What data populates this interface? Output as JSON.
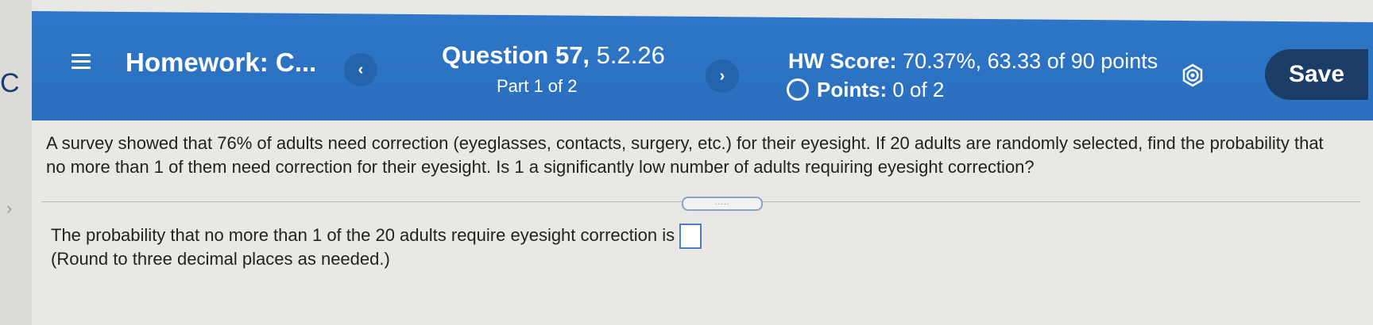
{
  "header": {
    "assignment_title": "Homework: C...",
    "question_title": "Question 57,",
    "question_number": "5.2.26",
    "part": "Part 1 of 2",
    "hw_score_label": "HW Score:",
    "hw_score_value": "70.37%, 63.33 of 90 points",
    "points_label": "Points:",
    "points_value": "0 of 2",
    "prev_label": "‹",
    "next_label": "›",
    "save_label": "Save",
    "colors": {
      "bar": "#2f77c9",
      "save_button": "#1b3d68"
    }
  },
  "browser_edge": {
    "partial_letter": "C",
    "chevron": "›"
  },
  "question": {
    "text": "A survey showed that 76% of adults need correction (eyeglasses, contacts, surgery, etc.) for their eyesight. If 20 adults are randomly selected, find the probability that no more than 1 of them need correction for their eyesight. Is 1 a significantly low number of adults requiring eyesight correction?",
    "divider_handle": "....."
  },
  "answer": {
    "prompt": "The probability that no more than 1 of the 20 adults require eyesight correction is",
    "input_value": "",
    "note": "(Round to three decimal places as needed.)"
  },
  "icons": {
    "menu": "menu-icon",
    "gear": "gear-icon",
    "status": "circle-outline-icon"
  }
}
